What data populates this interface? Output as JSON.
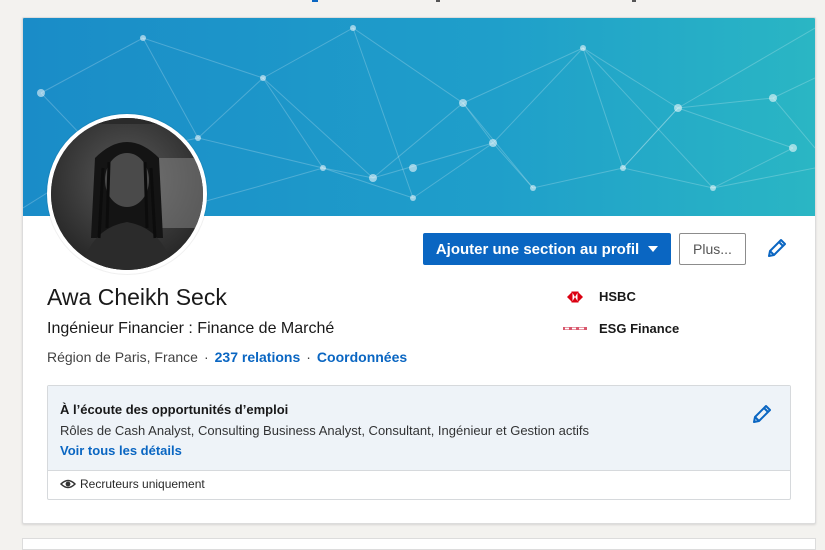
{
  "profile": {
    "name": "Awa Cheikh Seck",
    "headline": "Ingénieur Financier : Finance de Marché",
    "location": "Région de Paris, France",
    "separator": "·",
    "relations_link": "237 relations",
    "contact_link": "Coordonnées"
  },
  "actions": {
    "add_section_label": "Ajouter une section au profil",
    "more_label": "Plus..."
  },
  "organizations": [
    {
      "name": "HSBC",
      "logo": "hsbc-logo"
    },
    {
      "name": "ESG Finance",
      "logo": "esg-finance-logo"
    }
  ],
  "open_to_work": {
    "title": "À l’écoute des opportunités d’emploi",
    "roles": "Rôles de Cash Analyst, Consulting Business Analyst, Consultant, Ingénieur et Gestion actifs",
    "details_link": "Voir tous les détails",
    "visibility": "Recruteurs uniquement"
  },
  "colors": {
    "primary": "#0a66c2",
    "banner_start": "#1b8fc9",
    "banner_end": "#2ab3c6",
    "hsbc_red": "#db0011"
  },
  "icons": [
    "pencil-icon",
    "eye-icon",
    "caret-down-icon"
  ]
}
